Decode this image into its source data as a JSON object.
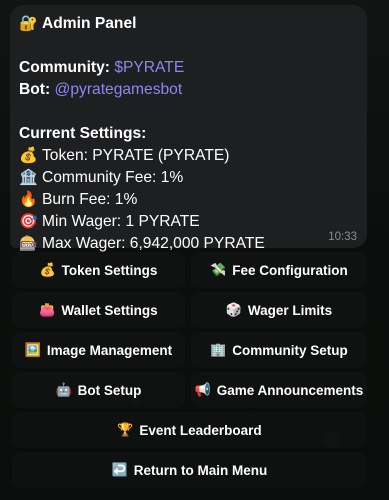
{
  "message": {
    "title_icon": "🔐",
    "title": "Admin Panel",
    "community_label": "Community:",
    "community_value": "$PYRATE",
    "bot_label": "Bot:",
    "bot_value": "@pyrategamesbot",
    "settings_heading": "Current Settings:",
    "settings": [
      {
        "icon": "💰",
        "icon_name": "money-bag-icon",
        "text": "Token: PYRATE (PYRATE)"
      },
      {
        "icon": "🏦",
        "icon_name": "bank-icon",
        "text": "Community Fee: 1%"
      },
      {
        "icon": "🔥",
        "icon_name": "fire-icon",
        "text": "Burn Fee: 1%"
      },
      {
        "icon": "🎯",
        "icon_name": "target-icon",
        "text": "Min Wager: 1 PYRATE"
      },
      {
        "icon": "🎰",
        "icon_name": "slot-machine-icon",
        "text": "Max Wager: 6,942,000 PYRATE"
      }
    ],
    "time": "10:33"
  },
  "keyboard": [
    {
      "icon": "💰",
      "icon_name": "money-bag-icon",
      "label": "Token Settings"
    },
    {
      "icon": "💸",
      "icon_name": "money-wings-icon",
      "label": "Fee Configuration"
    },
    {
      "icon": "👛",
      "icon_name": "purse-icon",
      "label": "Wallet Settings"
    },
    {
      "icon": "🎲",
      "icon_name": "dice-icon",
      "label": "Wager Limits"
    },
    {
      "icon": "🖼️",
      "icon_name": "framed-picture-icon",
      "label": "Image Management"
    },
    {
      "icon": "🏢",
      "icon_name": "office-building-icon",
      "label": "Community Setup"
    },
    {
      "icon": "🤖",
      "icon_name": "robot-icon",
      "label": "Bot Setup"
    },
    {
      "icon": "📢",
      "icon_name": "loudspeaker-icon",
      "label": "Game Announcements"
    },
    {
      "icon": "🏆",
      "icon_name": "trophy-icon",
      "label": "Event Leaderboard"
    },
    {
      "icon": "↩️",
      "icon_name": "return-arrow-icon",
      "label": "Return to Main Menu"
    }
  ],
  "colors": {
    "link": "#8f86f4",
    "bubble": "#1e1f21",
    "timestamp": "#8a8d90"
  }
}
